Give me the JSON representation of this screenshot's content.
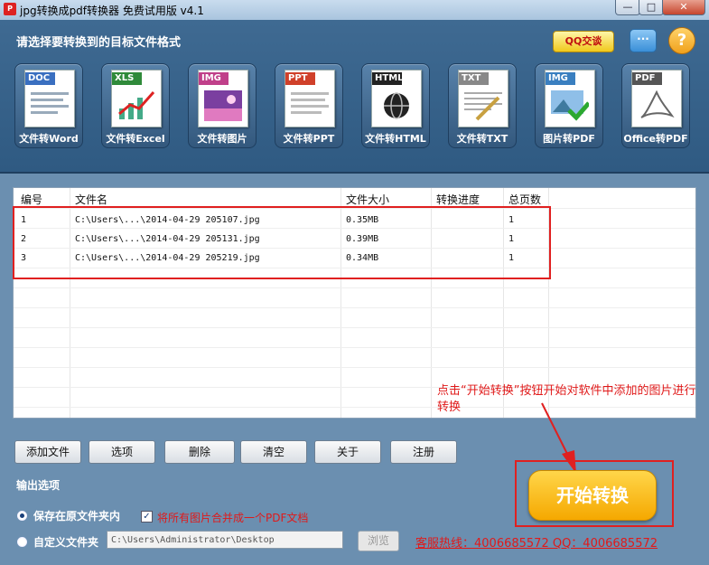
{
  "window": {
    "title": "jpg转换成pdf转换器 免费试用版 v4.1",
    "controls": {
      "minimize": "—",
      "maximize": "□",
      "close": "✕"
    }
  },
  "header": {
    "title": "请选择要转换到的目标文件格式",
    "qq_label": "QQ交谈",
    "chat_icon": "chat-bubble-icon",
    "help_icon": "question-icon",
    "formats": [
      {
        "tag": "DOC",
        "label": "文件转Word",
        "color": "#3a6fc0"
      },
      {
        "tag": "XLS",
        "label": "文件转Excel",
        "color": "#2f8a3a"
      },
      {
        "tag": "IMG",
        "label": "文件转图片",
        "color": "#c0408a"
      },
      {
        "tag": "PPT",
        "label": "文件转PPT",
        "color": "#d0402a"
      },
      {
        "tag": "HTML",
        "label": "文件转HTML",
        "color": "#222222"
      },
      {
        "tag": "TXT",
        "label": "文件转TXT",
        "color": "#888888"
      },
      {
        "tag": "IMG",
        "label": "图片转PDF",
        "color": "#3a7fc0"
      },
      {
        "tag": "PDF",
        "label": "Office转PDF",
        "color": "#555555"
      }
    ]
  },
  "table": {
    "columns": [
      "编号",
      "文件名",
      "文件大小",
      "转换进度",
      "总页数"
    ],
    "rows": [
      {
        "no": "1",
        "name": "C:\\Users\\...\\2014-04-29 205107.jpg",
        "size": "0.35MB",
        "progress": "",
        "pages": "1"
      },
      {
        "no": "2",
        "name": "C:\\Users\\...\\2014-04-29 205131.jpg",
        "size": "0.39MB",
        "progress": "",
        "pages": "1"
      },
      {
        "no": "3",
        "name": "C:\\Users\\...\\2014-04-29 205219.jpg",
        "size": "0.34MB",
        "progress": "",
        "pages": "1"
      }
    ],
    "hint": "点击“开始转换”按钮开始对软件中添加的图片进行转换"
  },
  "actions": {
    "add_file": "添加文件",
    "options": "选项",
    "delete": "删除",
    "clear": "清空",
    "about": "关于",
    "register": "注册"
  },
  "output": {
    "section_title": "输出选项",
    "save_original": "保存在原文件夹内",
    "merge_label": "将所有图片合并成一个PDF文档",
    "merge_checked": true,
    "custom_folder": "自定义文件夹",
    "folder_path": "C:\\Users\\Administrator\\Desktop",
    "browse": "浏览",
    "hotline": "客服热线：4006685572 QQ：4006685572",
    "selected": "save_original"
  },
  "start_button": "开始转换"
}
